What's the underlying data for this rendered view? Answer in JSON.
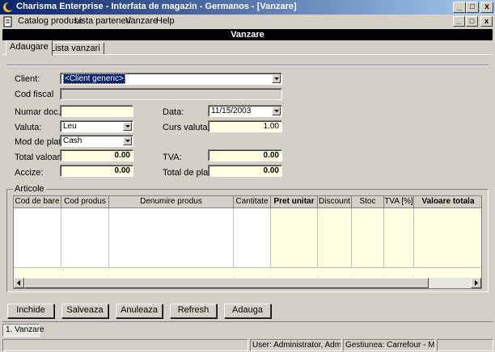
{
  "window": {
    "title": "Charisma Enterprise - Interfata de magazin - Germanos - [Vanzare]",
    "min_glyph": "_",
    "max_glyph": "□",
    "close_glyph": "x"
  },
  "menu": {
    "items": [
      "Catalog produse",
      "Lista parteneri",
      "Vanzare",
      "Help"
    ]
  },
  "form": {
    "header": "Vanzare",
    "tabs": [
      "Adaugare",
      "Lista vanzari"
    ],
    "client_label": "Client:",
    "client_value": "<Client generic>",
    "cod_fiscal_label": "Cod fiscal",
    "numar_doc_label": "Numar doc.:",
    "data_label": "Data:",
    "data_value": "11/15/2003",
    "valuta_label": "Valuta:",
    "valuta_value": "Leu",
    "curs_label": "Curs valutar:",
    "curs_value": "1.00",
    "mod_plata_label": "Mod de plata:",
    "mod_plata_value": "Cash",
    "total_valoare_label": "Total valoare:",
    "total_valoare_value": "0.00",
    "tva_label": "TVA:",
    "tva_value": "0.00",
    "accize_label": "Accize:",
    "accize_value": "0.00",
    "total_plata_label": "Total de plata:",
    "total_plata_value": "0.00"
  },
  "articole": {
    "label": "Articole",
    "columns": [
      "Cod de bare",
      "Cod produs",
      "Denumire produs",
      "Cantitate",
      "Pret unitar",
      "Discount",
      "Stoc",
      "TVA [%]",
      "Valoare totala"
    ]
  },
  "buttons": [
    "Inchide",
    "Salveaza",
    "Anuleaza",
    "Refresh",
    "Adauga"
  ],
  "window_tab": "1. Vanzare",
  "status": {
    "user": "User: Administrator, Administr",
    "gestiune": "Gestiunea: Carrefour - Marfa V"
  }
}
